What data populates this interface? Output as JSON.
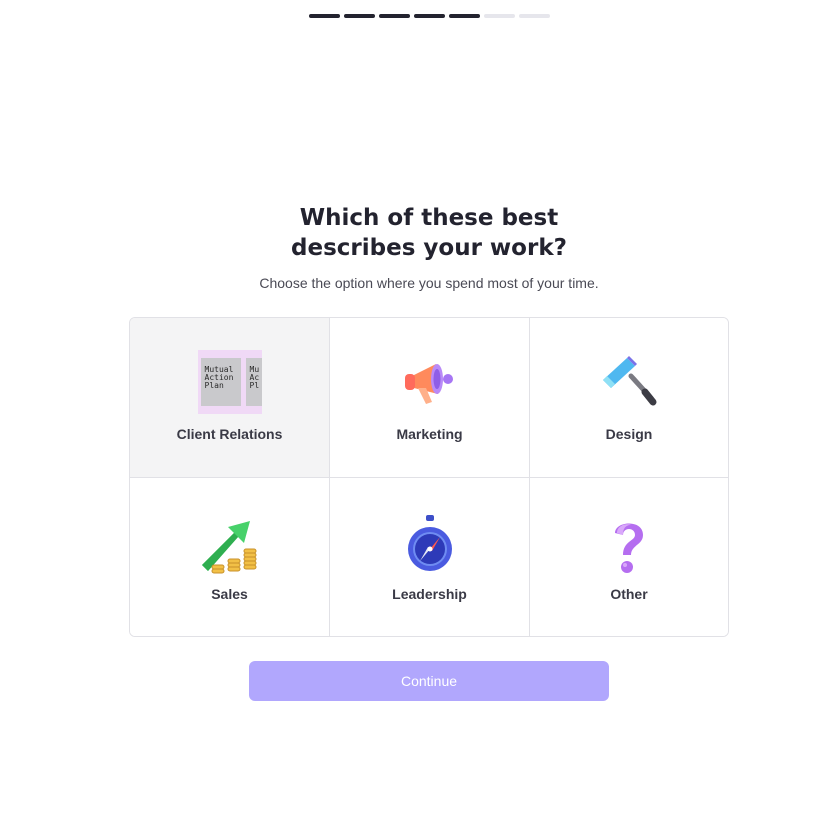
{
  "progress": {
    "total_steps": 7,
    "completed_steps": 5
  },
  "heading": {
    "line1": "Which of these best",
    "line2": "describes your work?",
    "subtitle": "Choose the option where you spend most of your time."
  },
  "options": [
    {
      "label": "Client Relations",
      "icon": "mutual-action-plan-thumbnail",
      "selected": true,
      "thumb_text": [
        "Mutual",
        "Action",
        "Plan"
      ]
    },
    {
      "label": "Marketing",
      "icon": "megaphone-icon",
      "selected": false
    },
    {
      "label": "Design",
      "icon": "paint-roller-icon",
      "selected": false
    },
    {
      "label": "Sales",
      "icon": "growth-chart-coins-icon",
      "selected": false
    },
    {
      "label": "Leadership",
      "icon": "compass-icon",
      "selected": false
    },
    {
      "label": "Other",
      "icon": "question-mark-icon",
      "selected": false
    }
  ],
  "continue_button": {
    "label": "Continue",
    "color": "#b1a7fd"
  },
  "colors": {
    "progress_done": "#23232f",
    "progress_todo": "#e6e6ec",
    "selected_bg": "#f4f4f5"
  }
}
